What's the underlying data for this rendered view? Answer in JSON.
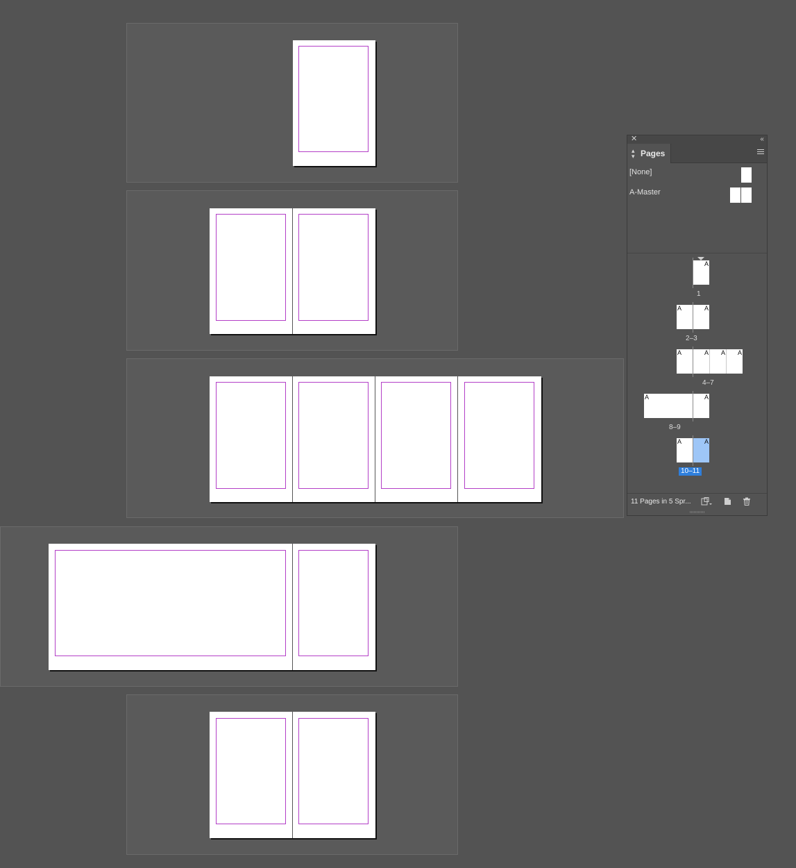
{
  "panel": {
    "title": "Pages",
    "close_glyph": "✕",
    "collapse_glyph": "‹‹",
    "masters": [
      {
        "label": "[None]"
      },
      {
        "label": "A-Master"
      }
    ],
    "spreads": [
      {
        "label": "1",
        "master_letters": [
          "A"
        ]
      },
      {
        "label": "2–3",
        "master_letters": [
          "A",
          "A"
        ]
      },
      {
        "label": "4–7",
        "master_letters": [
          "A",
          "A",
          "A",
          "A"
        ]
      },
      {
        "label": "8–9",
        "master_letters": [
          "A",
          "A"
        ]
      },
      {
        "label": "10–11",
        "master_letters": [
          "A",
          "A"
        ],
        "selected": true
      }
    ],
    "footer_text": "11 Pages in 5 Spr...",
    "icons": [
      "page-size-icon",
      "new-page-icon",
      "delete-page-icon"
    ]
  },
  "colors": {
    "background": "#535353",
    "margin_guide": "#b33ec7",
    "selection": "#2f7fdc"
  }
}
